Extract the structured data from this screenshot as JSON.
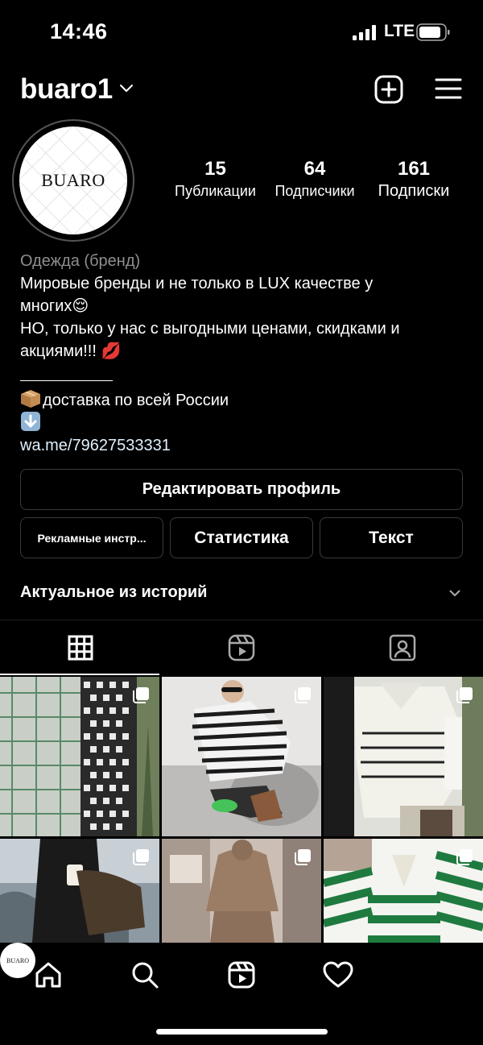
{
  "status_bar": {
    "time": "14:46",
    "network": "LTE",
    "icons": [
      "signal-icon",
      "battery-icon"
    ]
  },
  "header": {
    "username": "buaro1",
    "icons": [
      "chevron-down-icon",
      "add-post-icon",
      "menu-icon"
    ]
  },
  "profile": {
    "avatar_text": "BUARO",
    "stats": {
      "posts": {
        "value": "15",
        "label": "Публикации"
      },
      "followers": {
        "value": "64",
        "label": "Подписчики"
      },
      "following": {
        "value": "161",
        "label": "Подписки"
      }
    },
    "bio": {
      "category": "Одежда (бренд)",
      "line1": "Мировые бренды и не только в LUX качестве у",
      "line2": "многих😌",
      "line3": "НО, только у нас с выгодными ценами, скидками и",
      "line4": "акциями!!! 💋",
      "delivery": "доставка по всей России",
      "link": "wa.me/79627533331"
    }
  },
  "buttons": {
    "edit_profile": "Редактировать профиль",
    "ads_tools": "Рекламные инстр...",
    "statistics": "Статистика",
    "text": "Текст"
  },
  "highlights": {
    "label": "Актуальное из историй"
  },
  "tabs": [
    "grid-icon",
    "reels-icon",
    "tagged-icon"
  ],
  "posts": [
    {
      "name": "post-tweed-jacket"
    },
    {
      "name": "post-striped-sweater-woman"
    },
    {
      "name": "post-striped-sweater-white"
    },
    {
      "name": "post-black-knit-coffee"
    },
    {
      "name": "post-brown-hoodie-set"
    },
    {
      "name": "post-green-striped-sweater"
    }
  ],
  "bottom_nav": {
    "profile_text": "BUARO",
    "icons": [
      "home-icon",
      "search-icon",
      "reels-icon",
      "heart-icon",
      "profile-avatar"
    ]
  },
  "colors": {
    "background": "#000000",
    "text": "#ffffff",
    "muted": "#8e8e8e",
    "border": "#3a3a3a",
    "link": "#e0f1ff"
  }
}
